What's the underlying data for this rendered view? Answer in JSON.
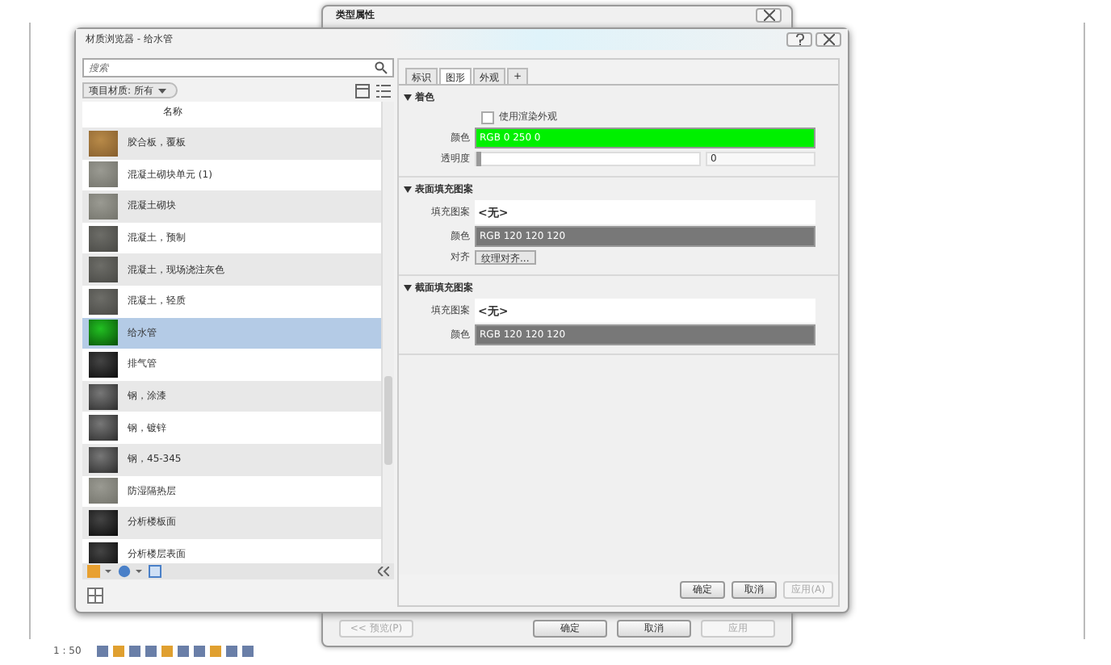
{
  "background_window": {
    "title": "类型属性",
    "buttons": [
      {
        "label": "<< 预览(P)",
        "disabled": true
      },
      {
        "label": "确定",
        "disabled": false
      },
      {
        "label": "取消",
        "disabled": false
      },
      {
        "label": "应用",
        "disabled": true
      }
    ]
  },
  "status_bar": {
    "scale": "1 : 50"
  },
  "material_browser": {
    "title": "材质浏览器 - 给水管",
    "search": {
      "placeholder": "搜索"
    },
    "filter": "项目材质: 所有",
    "list_header": "名称",
    "materials": [
      {
        "name": "胶合板，覆板",
        "kind": "wood",
        "selected": false
      },
      {
        "name": "混凝土砌块单元 (1)",
        "kind": "concrete",
        "selected": false
      },
      {
        "name": "混凝土砌块",
        "kind": "concrete",
        "selected": false
      },
      {
        "name": "混凝土，预制",
        "kind": "darkconcrete",
        "selected": false
      },
      {
        "name": "混凝土，现场浇注灰色",
        "kind": "darkconcrete",
        "selected": false
      },
      {
        "name": "混凝土，轻质",
        "kind": "darkconcrete",
        "selected": false
      },
      {
        "name": "给水管",
        "kind": "green",
        "selected": true
      },
      {
        "name": "排气管",
        "kind": "dark",
        "selected": false
      },
      {
        "name": "钢，涂漆",
        "kind": "metal",
        "selected": false
      },
      {
        "name": "钢，镀锌",
        "kind": "metal",
        "selected": false
      },
      {
        "name": "钢，45-345",
        "kind": "metal",
        "selected": false
      },
      {
        "name": "防湿隔热层",
        "kind": "concrete",
        "selected": false
      },
      {
        "name": "分析楼板面",
        "kind": "dark",
        "selected": false
      },
      {
        "name": "分析楼层表面",
        "kind": "dark",
        "selected": false
      }
    ],
    "tabs": [
      {
        "label": "标识",
        "selected": false
      },
      {
        "label": "图形",
        "selected": true
      },
      {
        "label": "外观",
        "selected": false
      },
      {
        "label": "+",
        "selected": false
      }
    ],
    "sections": [
      {
        "title": "着色",
        "expanded": true,
        "fields": [
          {
            "kind": "checkbox",
            "label": "使用渲染外观",
            "checked": false
          },
          {
            "kind": "color",
            "label": "颜色",
            "value": "RGB 0 250 0",
            "color": "#00f000"
          },
          {
            "kind": "slider",
            "label": "透明度",
            "level": 0,
            "value": "0"
          }
        ]
      },
      {
        "title": "表面填充图案",
        "expanded": true,
        "fields": [
          {
            "kind": "pattern",
            "label": "填充图案",
            "value": "<无>"
          },
          {
            "kind": "color",
            "label": "颜色",
            "value": "RGB 120 120 120",
            "color": "#787878"
          },
          {
            "kind": "button",
            "label": "对齐",
            "value": "纹理对齐..."
          }
        ]
      },
      {
        "title": "截面填充图案",
        "expanded": true,
        "fields": [
          {
            "kind": "pattern",
            "label": "填充图案",
            "value": "<无>"
          },
          {
            "kind": "color",
            "label": "颜色",
            "value": "RGB 120 120 120",
            "color": "#787878"
          }
        ]
      }
    ],
    "buttons": [
      {
        "label": "确定",
        "disabled": false
      },
      {
        "label": "取消",
        "disabled": false
      },
      {
        "label": "应用(A)",
        "disabled": true
      }
    ]
  }
}
